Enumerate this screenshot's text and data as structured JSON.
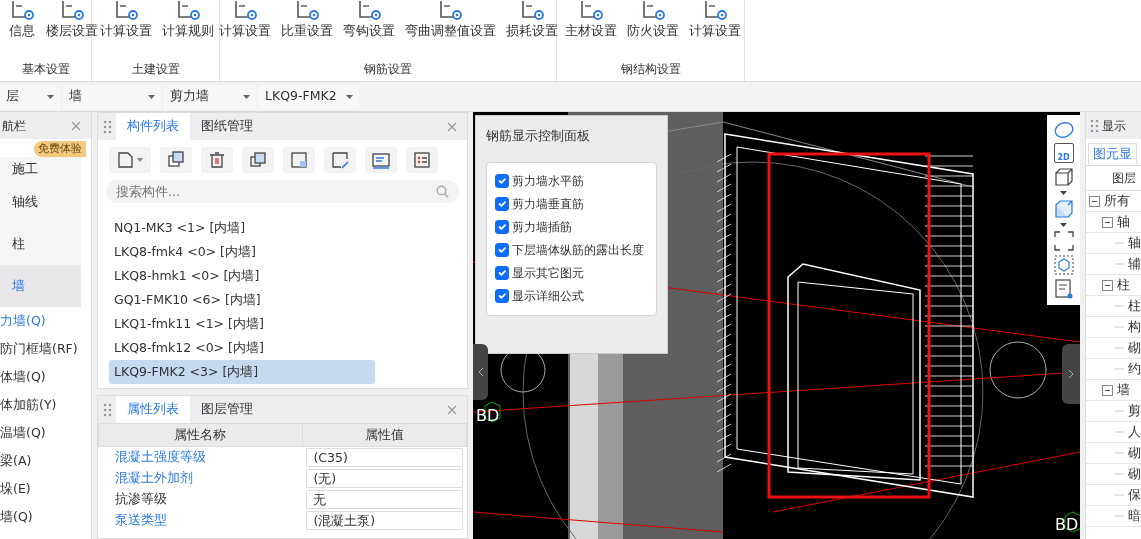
{
  "ribbon": {
    "groups": [
      {
        "label": "基本设置",
        "items": [
          "信息",
          "楼层设置"
        ]
      },
      {
        "label": "土建设置",
        "items": [
          "计算设置",
          "计算规则"
        ]
      },
      {
        "label": "钢筋设置",
        "items": [
          "计算设置",
          "比重设置",
          "弯钩设置",
          "弯曲调整值设置",
          "损耗设置"
        ]
      },
      {
        "label": "钢结构设置",
        "items": [
          "主材设置",
          "防火设置",
          "计算设置"
        ]
      }
    ]
  },
  "selectors": [
    "层",
    "墙",
    "剪力墙",
    "LKQ9-FMK2"
  ],
  "nav": {
    "title": "航栏",
    "badge": "免费体验",
    "items": [
      {
        "label": "施工",
        "selected": false
      },
      {
        "label": "轴线",
        "selected": false
      },
      {
        "label": "柱",
        "selected": false
      },
      {
        "label": "墙",
        "selected": true
      }
    ],
    "subitems": [
      {
        "label": "力墙(Q)",
        "selected": true
      },
      {
        "label": "防门框墙(RF)",
        "selected": false
      },
      {
        "label": "体墙(Q)",
        "selected": false
      },
      {
        "label": "体加筋(Y)",
        "selected": false
      },
      {
        "label": "温墙(Q)",
        "selected": false
      },
      {
        "label": "梁(A)",
        "selected": false
      },
      {
        "label": "垛(E)",
        "selected": false
      },
      {
        "label": "墙(Q)",
        "selected": false
      }
    ]
  },
  "component_panel": {
    "tabs": [
      {
        "label": "构件列表",
        "selected": true
      },
      {
        "label": "图纸管理",
        "selected": false
      }
    ],
    "search": {
      "placeholder": "搜索构件..."
    },
    "items": [
      {
        "label": "NQ1-MK3 <1> [内墙]",
        "selected": false
      },
      {
        "label": "LKQ8-fmk4 <0> [内墙]",
        "selected": false
      },
      {
        "label": "LKQ8-hmk1 <0> [内墙]",
        "selected": false
      },
      {
        "label": "GQ1-FMK10 <6> [内墙]",
        "selected": false
      },
      {
        "label": "LKQ1-fmk11 <1> [内墙]",
        "selected": false
      },
      {
        "label": "LKQ8-fmk12 <0> [内墙]",
        "selected": false
      },
      {
        "label": "LKQ9-FMK2 <3> [内墙]",
        "selected": true
      }
    ]
  },
  "properties_panel": {
    "tabs": [
      {
        "label": "属性列表",
        "selected": true
      },
      {
        "label": "图层管理",
        "selected": false
      }
    ],
    "columns": [
      "属性名称",
      "属性值"
    ],
    "rows": [
      {
        "name": "混凝土强度等级",
        "value": "(C35)",
        "linked": true
      },
      {
        "name": "混凝土外加剂",
        "value": "(无)",
        "linked": true
      },
      {
        "name": "抗渗等级",
        "value": "无",
        "linked": false
      },
      {
        "name": "泵送类型",
        "value": "(混凝土泵)",
        "linked": true
      }
    ]
  },
  "rebar_panel": {
    "title": "钢筋显示控制面板",
    "options": [
      {
        "label": "剪力墙水平筋",
        "checked": true
      },
      {
        "label": "剪力墙垂直筋",
        "checked": true
      },
      {
        "label": "剪力墙插筋",
        "checked": true
      },
      {
        "label": "下层墙体纵筋的露出长度",
        "checked": true
      },
      {
        "label": "显示其它图元",
        "checked": true
      },
      {
        "label": "显示详细公式",
        "checked": true
      }
    ]
  },
  "canvas": {
    "labels": [
      "BD",
      "BD"
    ],
    "view_2d_label": "2D"
  },
  "display_panel": {
    "title": "显示",
    "tabs": [
      {
        "label": "图元显",
        "selected": true
      }
    ],
    "column": "图层",
    "tree": [
      {
        "label": "所有",
        "expanded": true,
        "children": [
          {
            "label": "轴",
            "expanded": true,
            "children": [
              {
                "label": "轴"
              },
              {
                "label": "辅"
              }
            ]
          },
          {
            "label": "柱",
            "expanded": true,
            "children": [
              {
                "label": "柱"
              },
              {
                "label": "构"
              },
              {
                "label": "砌"
              },
              {
                "label": "约"
              }
            ]
          },
          {
            "label": "墙",
            "expanded": true,
            "children": [
              {
                "label": "剪"
              },
              {
                "label": "人"
              },
              {
                "label": "砌"
              },
              {
                "label": "砌"
              },
              {
                "label": "保"
              },
              {
                "label": "暗"
              }
            ]
          }
        ]
      }
    ]
  }
}
